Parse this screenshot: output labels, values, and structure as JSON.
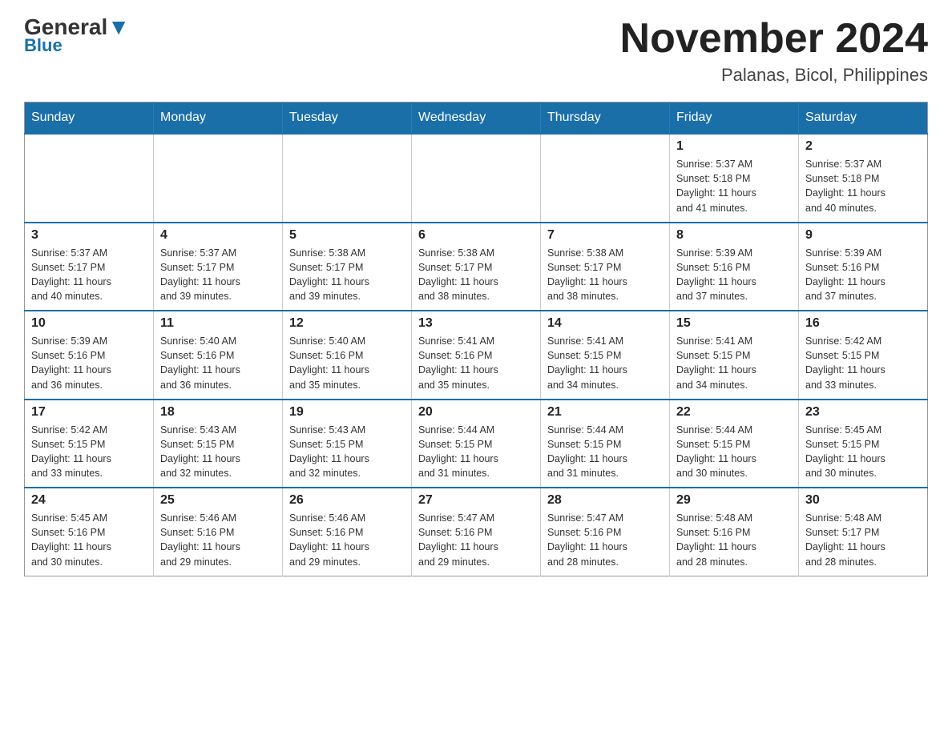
{
  "header": {
    "logo_general": "General",
    "logo_blue": "Blue",
    "month_year": "November 2024",
    "location": "Palanas, Bicol, Philippines"
  },
  "weekdays": [
    "Sunday",
    "Monday",
    "Tuesday",
    "Wednesday",
    "Thursday",
    "Friday",
    "Saturday"
  ],
  "weeks": [
    [
      {
        "day": "",
        "info": ""
      },
      {
        "day": "",
        "info": ""
      },
      {
        "day": "",
        "info": ""
      },
      {
        "day": "",
        "info": ""
      },
      {
        "day": "",
        "info": ""
      },
      {
        "day": "1",
        "info": "Sunrise: 5:37 AM\nSunset: 5:18 PM\nDaylight: 11 hours\nand 41 minutes."
      },
      {
        "day": "2",
        "info": "Sunrise: 5:37 AM\nSunset: 5:18 PM\nDaylight: 11 hours\nand 40 minutes."
      }
    ],
    [
      {
        "day": "3",
        "info": "Sunrise: 5:37 AM\nSunset: 5:17 PM\nDaylight: 11 hours\nand 40 minutes."
      },
      {
        "day": "4",
        "info": "Sunrise: 5:37 AM\nSunset: 5:17 PM\nDaylight: 11 hours\nand 39 minutes."
      },
      {
        "day": "5",
        "info": "Sunrise: 5:38 AM\nSunset: 5:17 PM\nDaylight: 11 hours\nand 39 minutes."
      },
      {
        "day": "6",
        "info": "Sunrise: 5:38 AM\nSunset: 5:17 PM\nDaylight: 11 hours\nand 38 minutes."
      },
      {
        "day": "7",
        "info": "Sunrise: 5:38 AM\nSunset: 5:17 PM\nDaylight: 11 hours\nand 38 minutes."
      },
      {
        "day": "8",
        "info": "Sunrise: 5:39 AM\nSunset: 5:16 PM\nDaylight: 11 hours\nand 37 minutes."
      },
      {
        "day": "9",
        "info": "Sunrise: 5:39 AM\nSunset: 5:16 PM\nDaylight: 11 hours\nand 37 minutes."
      }
    ],
    [
      {
        "day": "10",
        "info": "Sunrise: 5:39 AM\nSunset: 5:16 PM\nDaylight: 11 hours\nand 36 minutes."
      },
      {
        "day": "11",
        "info": "Sunrise: 5:40 AM\nSunset: 5:16 PM\nDaylight: 11 hours\nand 36 minutes."
      },
      {
        "day": "12",
        "info": "Sunrise: 5:40 AM\nSunset: 5:16 PM\nDaylight: 11 hours\nand 35 minutes."
      },
      {
        "day": "13",
        "info": "Sunrise: 5:41 AM\nSunset: 5:16 PM\nDaylight: 11 hours\nand 35 minutes."
      },
      {
        "day": "14",
        "info": "Sunrise: 5:41 AM\nSunset: 5:15 PM\nDaylight: 11 hours\nand 34 minutes."
      },
      {
        "day": "15",
        "info": "Sunrise: 5:41 AM\nSunset: 5:15 PM\nDaylight: 11 hours\nand 34 minutes."
      },
      {
        "day": "16",
        "info": "Sunrise: 5:42 AM\nSunset: 5:15 PM\nDaylight: 11 hours\nand 33 minutes."
      }
    ],
    [
      {
        "day": "17",
        "info": "Sunrise: 5:42 AM\nSunset: 5:15 PM\nDaylight: 11 hours\nand 33 minutes."
      },
      {
        "day": "18",
        "info": "Sunrise: 5:43 AM\nSunset: 5:15 PM\nDaylight: 11 hours\nand 32 minutes."
      },
      {
        "day": "19",
        "info": "Sunrise: 5:43 AM\nSunset: 5:15 PM\nDaylight: 11 hours\nand 32 minutes."
      },
      {
        "day": "20",
        "info": "Sunrise: 5:44 AM\nSunset: 5:15 PM\nDaylight: 11 hours\nand 31 minutes."
      },
      {
        "day": "21",
        "info": "Sunrise: 5:44 AM\nSunset: 5:15 PM\nDaylight: 11 hours\nand 31 minutes."
      },
      {
        "day": "22",
        "info": "Sunrise: 5:44 AM\nSunset: 5:15 PM\nDaylight: 11 hours\nand 30 minutes."
      },
      {
        "day": "23",
        "info": "Sunrise: 5:45 AM\nSunset: 5:15 PM\nDaylight: 11 hours\nand 30 minutes."
      }
    ],
    [
      {
        "day": "24",
        "info": "Sunrise: 5:45 AM\nSunset: 5:16 PM\nDaylight: 11 hours\nand 30 minutes."
      },
      {
        "day": "25",
        "info": "Sunrise: 5:46 AM\nSunset: 5:16 PM\nDaylight: 11 hours\nand 29 minutes."
      },
      {
        "day": "26",
        "info": "Sunrise: 5:46 AM\nSunset: 5:16 PM\nDaylight: 11 hours\nand 29 minutes."
      },
      {
        "day": "27",
        "info": "Sunrise: 5:47 AM\nSunset: 5:16 PM\nDaylight: 11 hours\nand 29 minutes."
      },
      {
        "day": "28",
        "info": "Sunrise: 5:47 AM\nSunset: 5:16 PM\nDaylight: 11 hours\nand 28 minutes."
      },
      {
        "day": "29",
        "info": "Sunrise: 5:48 AM\nSunset: 5:16 PM\nDaylight: 11 hours\nand 28 minutes."
      },
      {
        "day": "30",
        "info": "Sunrise: 5:48 AM\nSunset: 5:17 PM\nDaylight: 11 hours\nand 28 minutes."
      }
    ]
  ]
}
